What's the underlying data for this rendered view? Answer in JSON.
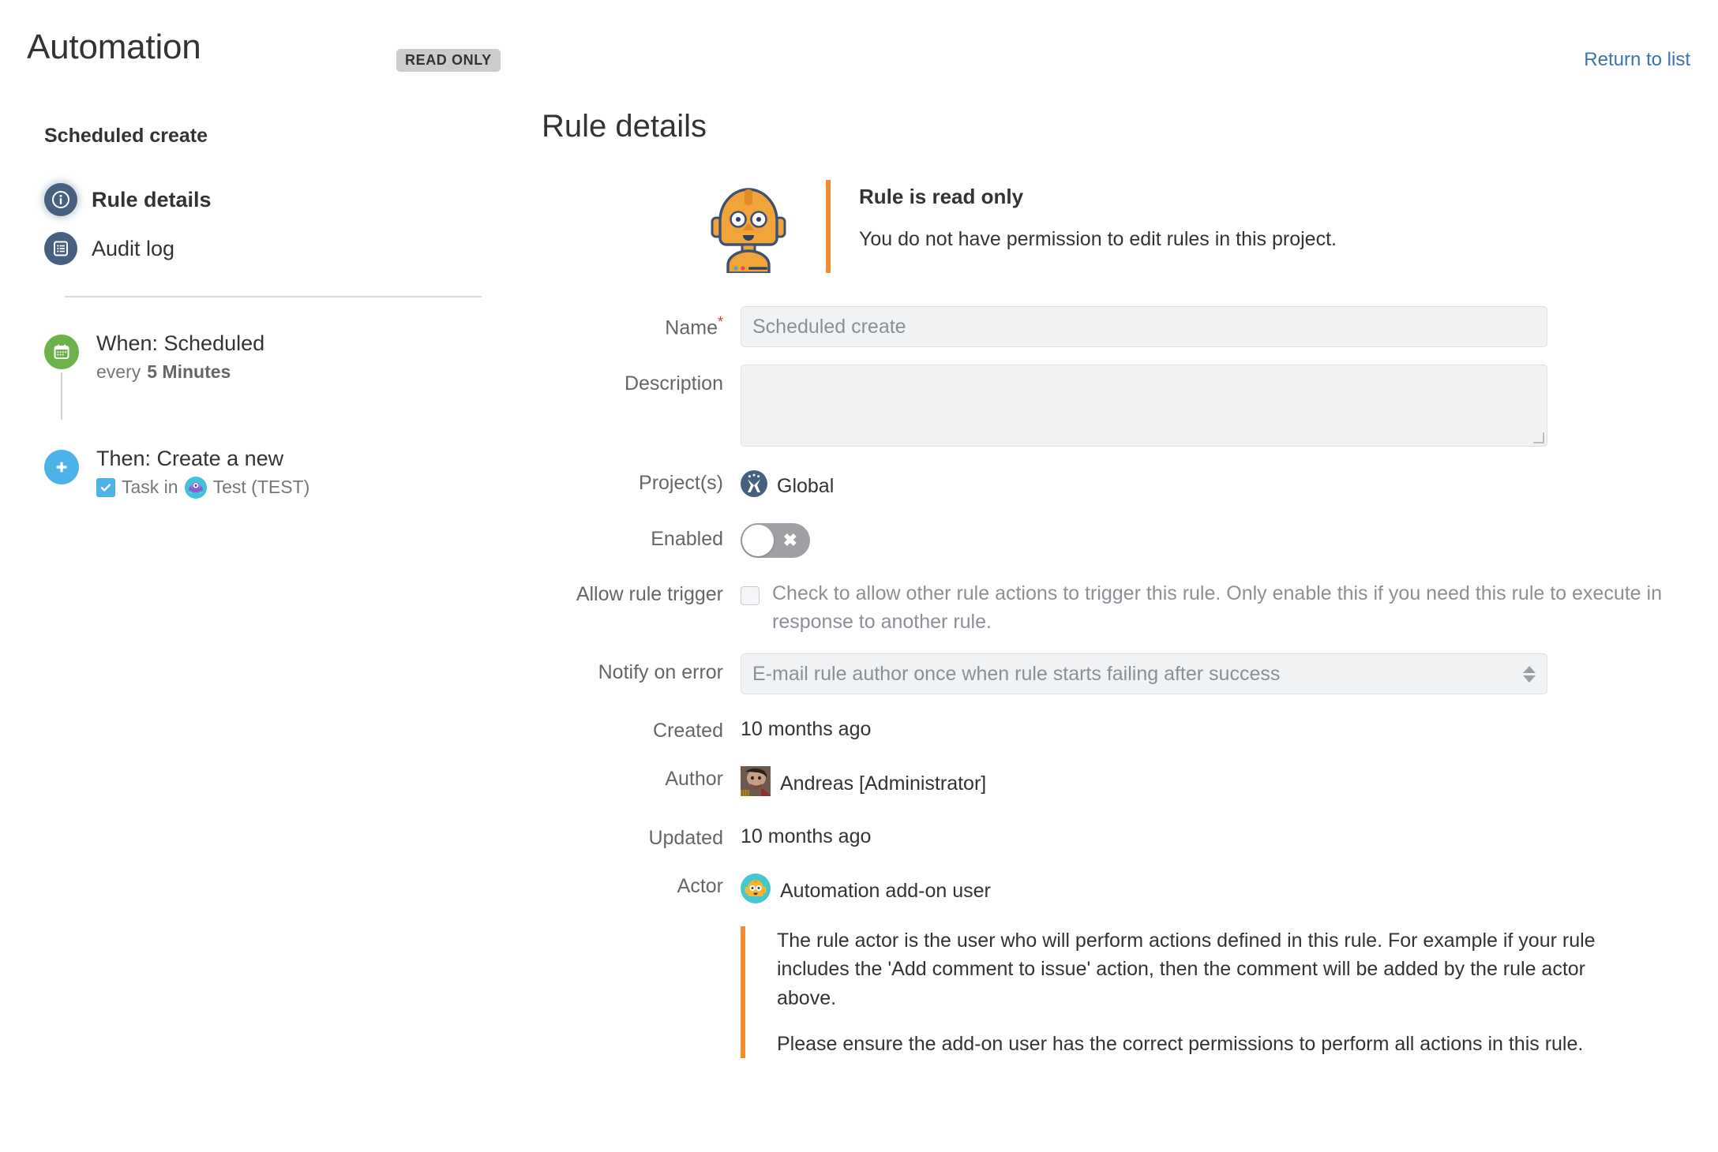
{
  "header": {
    "app_title": "Automation",
    "badge": "READ ONLY",
    "return_link": "Return to list"
  },
  "sidebar": {
    "rule_name": "Scheduled create",
    "nav": [
      {
        "label": "Rule details",
        "icon": "info-icon",
        "active": true
      },
      {
        "label": "Audit log",
        "icon": "list-icon",
        "active": false
      }
    ],
    "components": [
      {
        "title": "When: Scheduled",
        "sub_prefix": "every ",
        "sub_strong": "5 Minutes",
        "icon": "calendar-icon",
        "color": "#6cb24c"
      },
      {
        "title": "Then: Create a new",
        "sub_prefix": "Task in ",
        "project": "Test (TEST)",
        "icon": "plus-icon",
        "color": "#4bb3e8"
      }
    ]
  },
  "main": {
    "title": "Rule details",
    "banner": {
      "heading": "Rule is read only",
      "text": "You do not have permission to edit rules in this project.",
      "accent": "#f08c2e",
      "icon": "robot-icon"
    },
    "fields": {
      "name_label": "Name",
      "name_required": "*",
      "name_value": "Scheduled create",
      "description_label": "Description",
      "description_value": "",
      "projects_label": "Project(s)",
      "projects_value": "Global",
      "enabled_label": "Enabled",
      "enabled_state": "off",
      "enabled_glyph": "✖",
      "allow_trigger_label": "Allow rule trigger",
      "allow_trigger_checked": false,
      "allow_trigger_text": "Check to allow other rule actions to trigger this rule. Only enable this if you need this rule to execute in response to another rule.",
      "notify_label": "Notify on error",
      "notify_value": "E-mail rule author once when rule starts failing after success",
      "created_label": "Created",
      "created_value": "10 months ago",
      "author_label": "Author",
      "author_value": "Andreas [Administrator]",
      "updated_label": "Updated",
      "updated_value": "10 months ago",
      "actor_label": "Actor",
      "actor_value": "Automation add-on user"
    },
    "actor_note": {
      "paragraph_1": "The rule actor is the user who will perform actions defined in this rule. For example if your rule includes the 'Add comment to issue' action, then the comment will be added by the rule actor above.",
      "paragraph_2": "Please ensure the add-on user has the correct permissions to perform all actions in this rule."
    }
  },
  "colors": {
    "accent_orange": "#f08c2e",
    "link_blue": "#3b73af",
    "nav_icon_blue": "#46617f",
    "green": "#6cb24c",
    "blue": "#4bb3e8",
    "badge_grey": "#cccccc"
  }
}
